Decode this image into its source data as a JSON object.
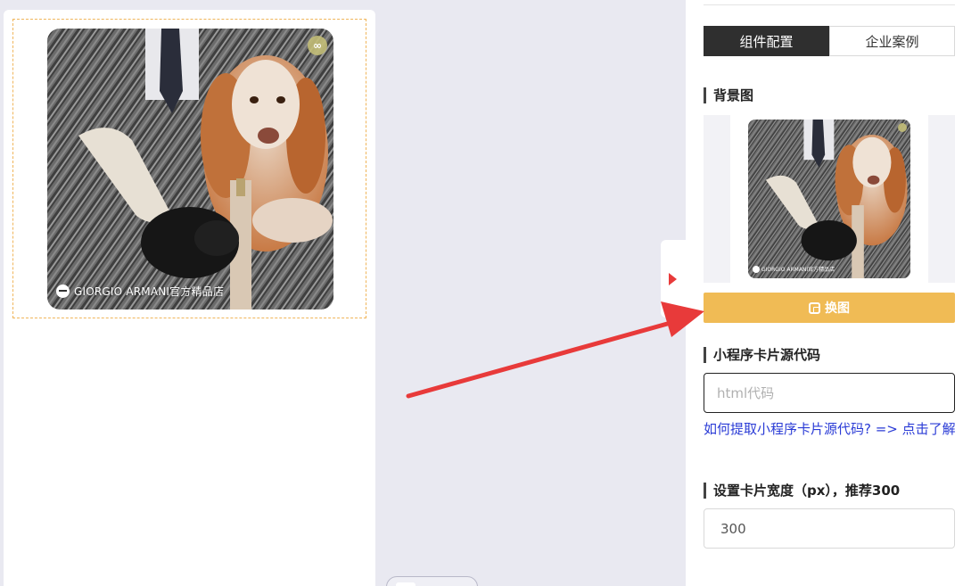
{
  "card": {
    "brand_text": "GIORGIO ARMANI官方精品店",
    "link_icon": "link-icon"
  },
  "right_panel": {
    "tabs": [
      {
        "label": "组件配置",
        "active": true
      },
      {
        "label": "企业案例",
        "active": false
      }
    ],
    "background_section": {
      "title": "背景图",
      "thumb_brand_text": "GIORGIO ARMANI官方精品店"
    },
    "swap_button_label": "换图",
    "source_code_section": {
      "title": "小程序卡片源代码",
      "placeholder": "html代码",
      "help_link": "如何提取小程序卡片源代码? => 点击了解"
    },
    "width_section": {
      "title": "设置卡片宽度（px），推荐300",
      "value": "300"
    }
  },
  "colors": {
    "accent_yellow": "#f0bb55",
    "tab_active_bg": "#2f2f2f",
    "link_blue": "#2a3bd6",
    "arrow_red": "#e83a3a",
    "dashed_frame": "#f0b55a"
  }
}
